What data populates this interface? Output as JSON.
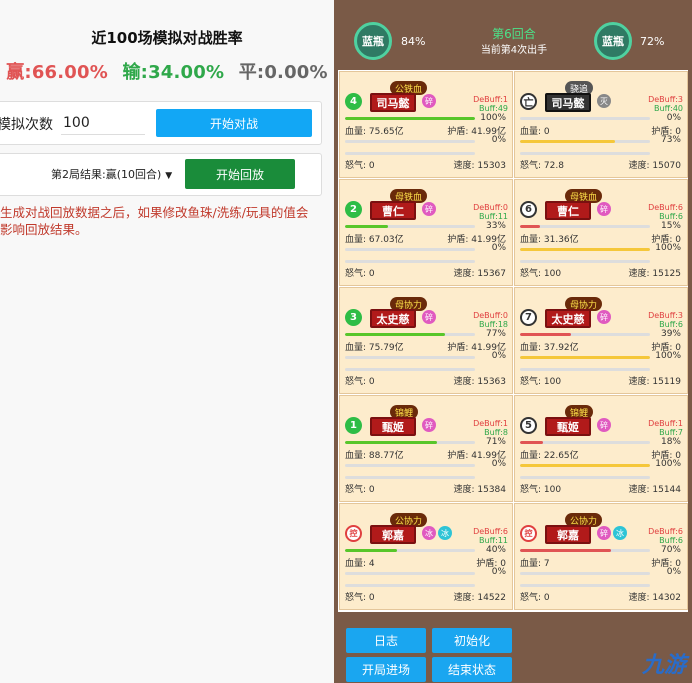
{
  "left": {
    "title": "近100场模拟对战胜率",
    "win": "赢:66.00%",
    "lose": "输:34.00%",
    "draw": "平:0.00%",
    "sim_label": "模拟次数",
    "sim_value": "100",
    "start_battle": "开始对战",
    "replay_select": "第2局结果:赢(10回合)",
    "start_replay": "开始回放",
    "warning": "生成对战回放数据之后，如果修改鱼珠/洗练/玩具的值会影响回放结果。"
  },
  "header": {
    "left_avatar": "蓝瓶",
    "left_pct": "84%",
    "right_avatar": "蓝瓶",
    "right_pct": "72%",
    "round": "第6回合",
    "sub": "当前第4次出手"
  },
  "cards_left": [
    {
      "pos": "4",
      "pos_style": "g",
      "name": "司马懿",
      "equip": "公铁血",
      "status": [
        "碎"
      ],
      "status_colors": [
        "pink"
      ],
      "debuff": "DeBuff:1",
      "buff": "Buff:49",
      "hp_pct": "100%",
      "hp_frac": 1.0,
      "hp_color": "green",
      "hp": "血量: 75.65亿",
      "shield": "护盾: 41.99亿",
      "shield_pct": "0%",
      "shield_frac": 0,
      "anger_pct": "",
      "anger_frac": 0,
      "anger": "怒气: 0",
      "speed": "速度: 15303"
    },
    {
      "pos": "2",
      "pos_style": "g",
      "name": "曹仁",
      "equip": "母铁血",
      "status": [
        "碎"
      ],
      "status_colors": [
        "pink"
      ],
      "debuff": "DeBuff:0",
      "buff": "Buff:11",
      "hp_pct": "33%",
      "hp_frac": 0.33,
      "hp_color": "green",
      "hp": "血量: 67.03亿",
      "shield": "护盾: 41.99亿",
      "shield_pct": "0%",
      "shield_frac": 0,
      "anger_pct": "",
      "anger_frac": 0,
      "anger": "怒气: 0",
      "speed": "速度: 15367"
    },
    {
      "pos": "3",
      "pos_style": "g",
      "name": "太史慈",
      "equip": "母协力",
      "status": [
        "碎"
      ],
      "status_colors": [
        "pink"
      ],
      "debuff": "DeBuff:0",
      "buff": "Buff:18",
      "hp_pct": "77%",
      "hp_frac": 0.77,
      "hp_color": "green",
      "hp": "血量: 75.79亿",
      "shield": "护盾: 41.99亿",
      "shield_pct": "0%",
      "shield_frac": 0,
      "anger_pct": "",
      "anger_frac": 0,
      "anger": "怒气: 0",
      "speed": "速度: 15363"
    },
    {
      "pos": "1",
      "pos_style": "g",
      "name": "甄姬",
      "equip": "锦鲤",
      "status": [
        "碎"
      ],
      "status_colors": [
        "pink"
      ],
      "debuff": "DeBuff:1",
      "buff": "Buff:8",
      "hp_pct": "71%",
      "hp_frac": 0.71,
      "hp_color": "green",
      "hp": "血量: 88.77亿",
      "shield": "护盾: 41.99亿",
      "shield_pct": "0%",
      "shield_frac": 0,
      "anger_pct": "",
      "anger_frac": 0,
      "anger": "怒气: 0",
      "speed": "速度: 15384"
    },
    {
      "pos": "控",
      "pos_style": "r",
      "name": "郭嘉",
      "equip": "公协力",
      "status": [
        "冰",
        "冰"
      ],
      "status_colors": [
        "pink",
        "cyan"
      ],
      "debuff": "DeBuff:6",
      "buff": "Buff:11",
      "hp_pct": "40%",
      "hp_frac": 0.4,
      "hp_color": "green",
      "hp": "血量: 4",
      "shield": "护盾: 0",
      "shield_pct": "0%",
      "shield_frac": 0,
      "anger_pct": "",
      "anger_frac": 0,
      "anger": "怒气: 0",
      "speed": "速度: 14522"
    }
  ],
  "cards_right": [
    {
      "pos": "亡",
      "pos_style": "w",
      "name": "司马懿",
      "equip": "骁追",
      "status": [
        "灭"
      ],
      "status_colors": [
        "gray"
      ],
      "debuff": "DeBuff:3",
      "buff": "Buff:40",
      "hp_pct": "0%",
      "hp_frac": 0,
      "hp_color": "red",
      "hp": "血量: 0",
      "shield": "护盾: 0",
      "shield_pct": "73%",
      "shield_frac": 0.73,
      "anger_pct": "",
      "anger_frac": 0,
      "anger": "怒气: 72.8",
      "speed": "速度: 15070"
    },
    {
      "pos": "6",
      "pos_style": "w",
      "name": "曹仁",
      "equip": "母铁血",
      "status": [
        "碎"
      ],
      "status_colors": [
        "pink"
      ],
      "debuff": "DeBuff:6",
      "buff": "Buff:6",
      "hp_pct": "15%",
      "hp_frac": 0.15,
      "hp_color": "red",
      "hp": "血量: 31.36亿",
      "shield": "护盾: 0",
      "shield_pct": "100%",
      "shield_frac": 1.0,
      "anger_pct": "",
      "anger_frac": 0,
      "anger": "怒气: 100",
      "speed": "速度: 15125"
    },
    {
      "pos": "7",
      "pos_style": "w",
      "name": "太史慈",
      "equip": "母协力",
      "status": [
        "碎"
      ],
      "status_colors": [
        "pink"
      ],
      "debuff": "DeBuff:3",
      "buff": "Buff:6",
      "hp_pct": "39%",
      "hp_frac": 0.39,
      "hp_color": "red",
      "hp": "血量: 37.92亿",
      "shield": "护盾: 0",
      "shield_pct": "100%",
      "shield_frac": 1.0,
      "anger_pct": "",
      "anger_frac": 0,
      "anger": "怒气: 100",
      "speed": "速度: 15119"
    },
    {
      "pos": "5",
      "pos_style": "w",
      "name": "甄姬",
      "equip": "锦鲤",
      "status": [
        "碎"
      ],
      "status_colors": [
        "pink"
      ],
      "debuff": "DeBuff:1",
      "buff": "Buff:7",
      "hp_pct": "18%",
      "hp_frac": 0.18,
      "hp_color": "red",
      "hp": "血量: 22.65亿",
      "shield": "护盾: 0",
      "shield_pct": "100%",
      "shield_frac": 1.0,
      "anger_pct": "",
      "anger_frac": 0,
      "anger": "怒气: 100",
      "speed": "速度: 15144"
    },
    {
      "pos": "控",
      "pos_style": "r",
      "name": "郭嘉",
      "equip": "公协力",
      "status": [
        "碎",
        "冰"
      ],
      "status_colors": [
        "pink",
        "cyan"
      ],
      "debuff": "DeBuff:6",
      "buff": "Buff:6",
      "hp_pct": "70%",
      "hp_frac": 0.7,
      "hp_color": "red",
      "hp": "血量: 7",
      "shield": "护盾: 0",
      "shield_pct": "0%",
      "shield_frac": 0,
      "anger_pct": "",
      "anger_frac": 0,
      "anger": "怒气: 0",
      "speed": "速度: 14302"
    }
  ],
  "buttons": {
    "log": "日志",
    "init": "初始化",
    "enter": "开局进场",
    "end": "结束状态"
  },
  "watermark": "九游"
}
